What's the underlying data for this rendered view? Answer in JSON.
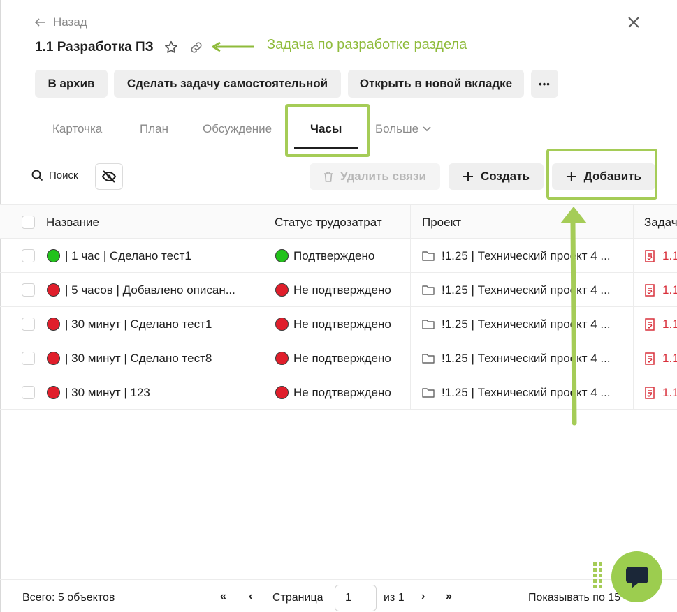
{
  "header": {
    "back_label": "Назад",
    "title": "1.1 Разработка ПЗ",
    "annotation": "Задача по разработке раздела"
  },
  "actions": {
    "archive": "В архив",
    "make_independent": "Сделать задачу самостоятельной",
    "open_new_tab": "Открыть в новой вкладке",
    "more": "•••"
  },
  "tabs": [
    {
      "label": "Карточка"
    },
    {
      "label": "План"
    },
    {
      "label": "Обсуждение"
    },
    {
      "label": "Часы",
      "active": true
    },
    {
      "label": "Больше"
    }
  ],
  "toolbar": {
    "search_label": "Поиск",
    "delete_links": "Удалить связи",
    "create": "Создать",
    "add": "Добавить"
  },
  "table": {
    "columns": [
      "Название",
      "Статус трудозатрат",
      "Проект",
      "Задач"
    ],
    "rows": [
      {
        "status_color": "green",
        "name": "| 1 час | Сделано тест1",
        "status": "Подтверждено",
        "project": "!1.25 | Технический проект 4 ...",
        "task": "1.1"
      },
      {
        "status_color": "red",
        "name": "| 5 часов | Добавлено описан...",
        "status": "Не подтверждено",
        "project": "!1.25 | Технический проект 4 ...",
        "task": "1.1"
      },
      {
        "status_color": "red",
        "name": "| 30 минут | Сделано тест1",
        "status": "Не подтверждено",
        "project": "!1.25 | Технический проект 4 ...",
        "task": "1.1"
      },
      {
        "status_color": "red",
        "name": "| 30 минут | Сделано тест8",
        "status": "Не подтверждено",
        "project": "!1.25 | Технический проект 4 ...",
        "task": "1.1"
      },
      {
        "status_color": "red",
        "name": "| 30 минут | 123",
        "status": "Не подтверждено",
        "project": "!1.25 | Технический проект 4 ...",
        "task": "1.1"
      }
    ]
  },
  "footer": {
    "total": "Всего: 5 объектов",
    "page_label": "Страница",
    "page_value": "1",
    "of_label": "из 1",
    "show_per_page": "Показывать по 15",
    "first": "«",
    "prev": "‹",
    "next": "›",
    "last": "»"
  },
  "colors": {
    "accent_green": "#a5cc57",
    "status_green": "#22c21b",
    "status_red": "#e01e2b"
  }
}
